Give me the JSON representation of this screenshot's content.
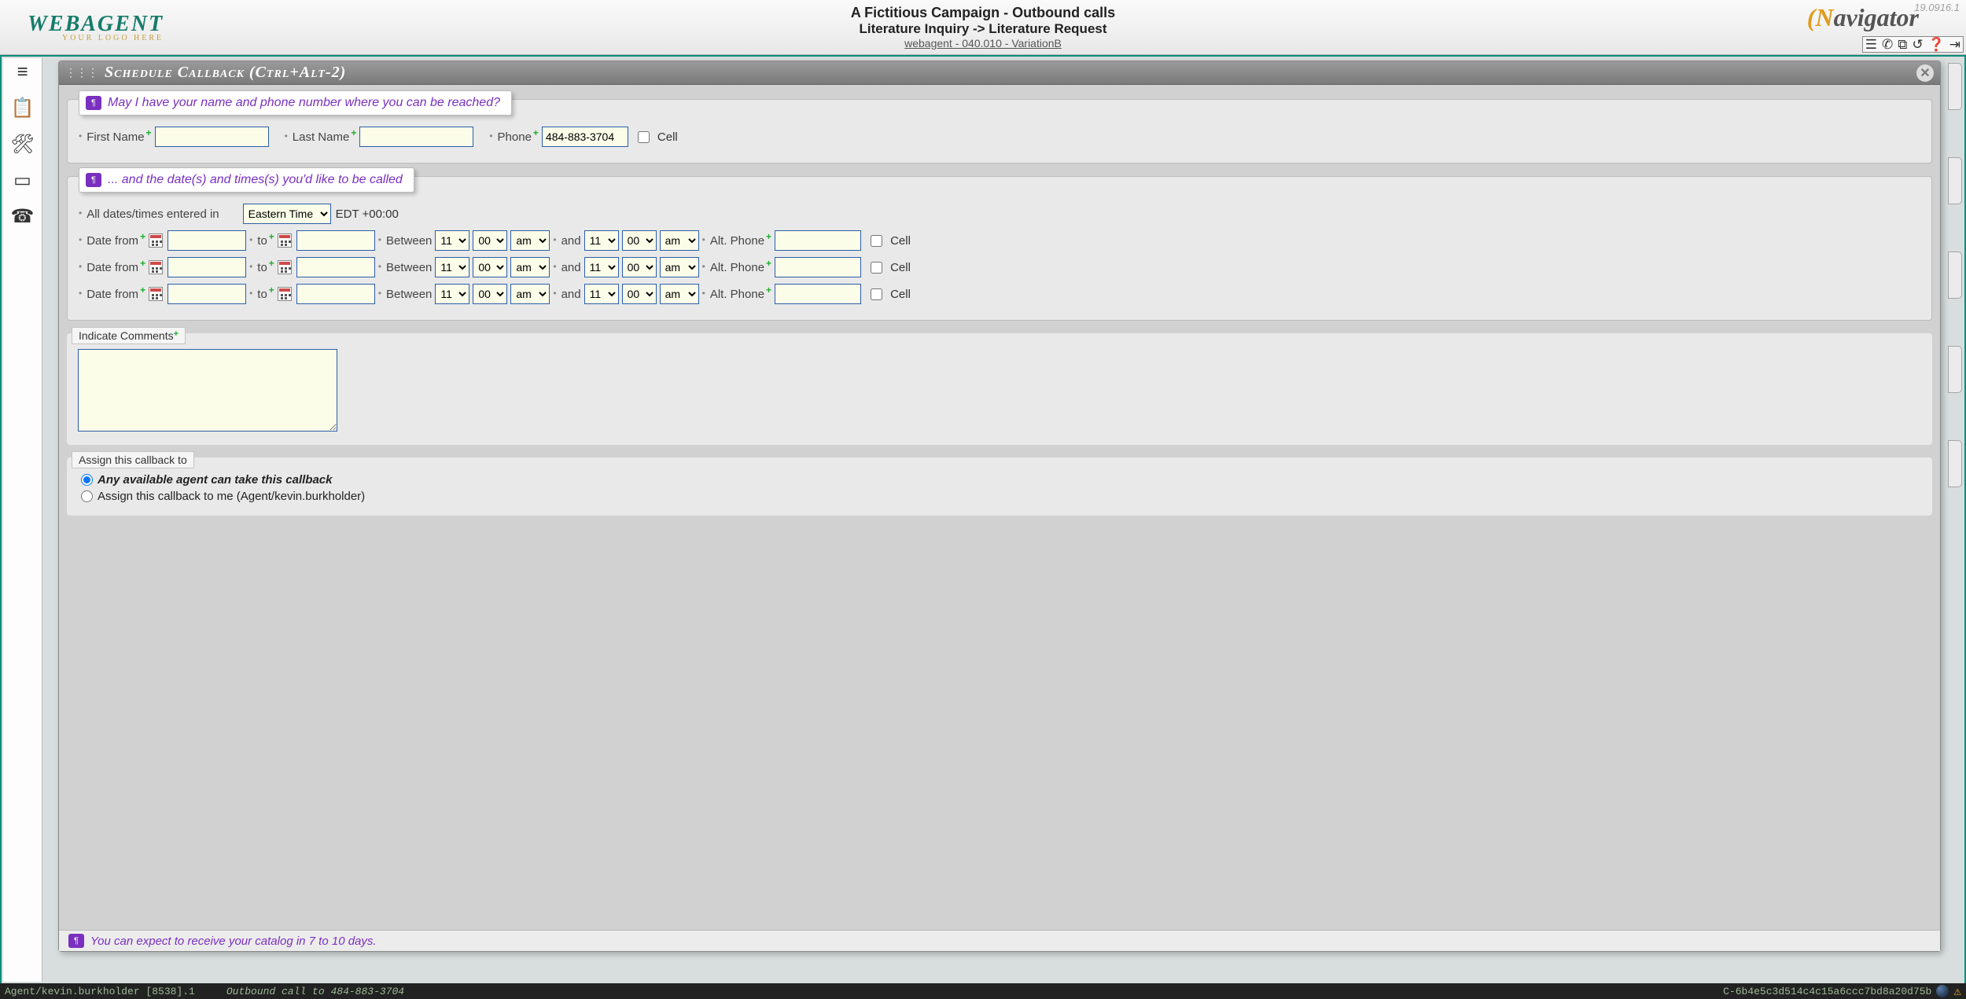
{
  "header": {
    "logo_main": "WEBAGENT",
    "logo_sub": "YOUR LOGO HERE",
    "title_line1": "A Fictitious Campaign - Outbound calls",
    "title_line2": "Literature Inquiry -> Literature Request",
    "title_line3": "webagent - 040.010 - VariationB",
    "version": "19.0916.1",
    "right_logo": "Navigator"
  },
  "modal_title": "Schedule Callback (Ctrl+Alt-2)",
  "prompt1": "May I have your name and phone number where you can be reached?",
  "prompt2": "... and the date(s) and times(s) you'd like to be called",
  "labels": {
    "first_name": "First Name",
    "last_name": "Last Name",
    "phone": "Phone",
    "cell": "Cell",
    "tz_intro": "All dates/times entered in",
    "tz_offset": "EDT +00:00",
    "date_from": "Date from",
    "to": "to",
    "between": "Between",
    "and": "and",
    "alt_phone": "Alt. Phone",
    "comments": "Indicate Comments",
    "assign": "Assign this callback to",
    "assign_any": "Any available agent can take this callback",
    "assign_me": "Assign this callback to me (Agent/kevin.burkholder)"
  },
  "values": {
    "first_name": "",
    "last_name": "",
    "phone": "484-883-3704",
    "timezone": "Eastern Time",
    "hour": "11",
    "minute": "00",
    "ampm": "am",
    "comments": ""
  },
  "footer_prompt": "You can expect to receive your catalog in 7 to 10 days.",
  "status": {
    "agent": "Agent/kevin.burkholder [8538].1",
    "call": "Outbound call to 484-883-3704",
    "hash": "C-6b4e5c3d514c4c15a6ccc7bd8a20d75b"
  }
}
